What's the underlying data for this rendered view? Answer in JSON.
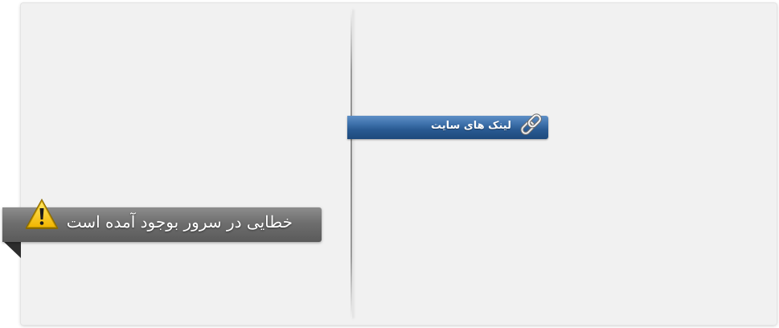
{
  "links_panel": {
    "title": "لینک های سایت",
    "icon": "link-icon",
    "bar_color": "#2f609a"
  },
  "error_banner": {
    "message": "خطایی در سرور بوجود آمده است",
    "icon": "warning-icon",
    "icon_color": "#f5c400",
    "ribbon_color": "#6e6e6e"
  }
}
